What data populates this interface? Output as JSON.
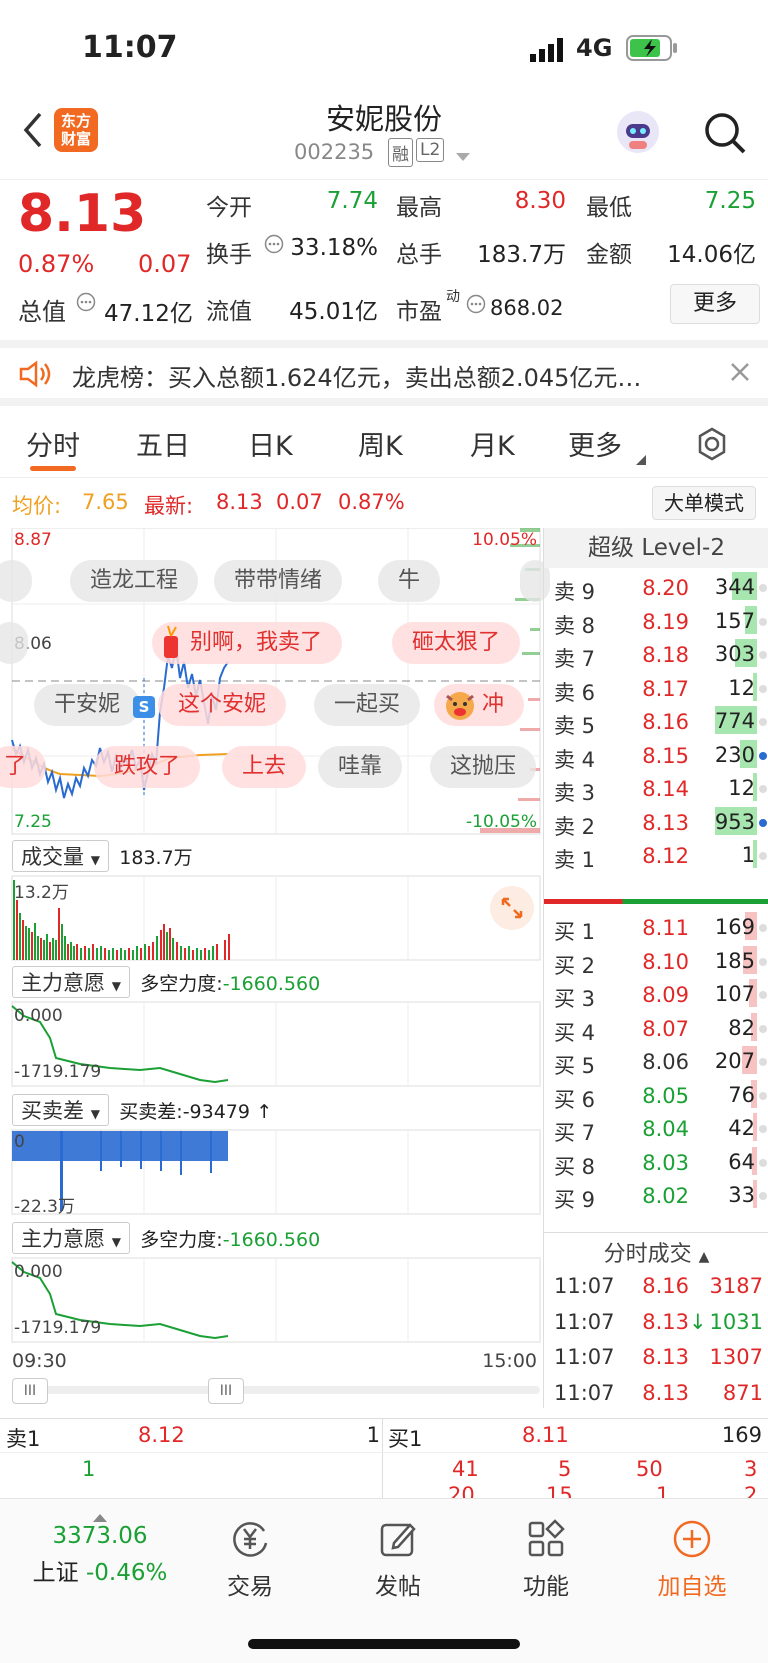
{
  "status": {
    "time": "11:07",
    "network": "4G"
  },
  "header": {
    "title": "安妮股份",
    "code": "002235",
    "badge1": "融",
    "badge2": "L2",
    "logo_line1": "东方",
    "logo_line2": "财富"
  },
  "quote": {
    "price": "8.13",
    "pct": "0.87%",
    "chg": "0.07",
    "open_label": "今开",
    "open": "7.74",
    "high_label": "最高",
    "high": "8.30",
    "low_label": "最低",
    "low": "7.25",
    "turnover_label": "换手",
    "turnover": "33.18%",
    "volume_label": "总手",
    "volume": "183.7万",
    "amount_label": "金额",
    "amount": "14.06亿",
    "mktcap_label": "总值",
    "mktcap": "47.12亿",
    "float_label": "流值",
    "float": "45.01亿",
    "pe_label": "市盈",
    "pe_sup": "动",
    "pe": "868.02",
    "more_button": "更多"
  },
  "notice": {
    "text": "龙虎榜：买入总额1.624亿元，卖出总额2.045亿元…"
  },
  "tabs": [
    "分时",
    "五日",
    "日K",
    "周K",
    "月K",
    "更多"
  ],
  "priceline": {
    "avg_label": "均价:",
    "avg": "7.65",
    "latest_label": "最新:",
    "latest": "8.13",
    "chg": "0.07",
    "pct": "0.87%",
    "mode_button": "大单模式"
  },
  "chart": {
    "price_top": "8.87",
    "price_mid": "8.06",
    "price_bottom": "7.25",
    "pct_top": "10.05%",
    "pct_bottom": "-10.05%",
    "vol_selector": "成交量",
    "vol_value": "183.7万",
    "vol_max": "13.2万",
    "ind1_selector": "主力意愿",
    "ind1_text": "多空力度:",
    "ind1_value": "-1660.560",
    "ind1_top": "0.000",
    "ind1_bottom": "-1719.179",
    "ind2_selector": "买卖差",
    "ind2_text": "买卖差:",
    "ind2_value": "-93479",
    "ind2_arrow": "↑",
    "ind2_top": "0",
    "ind2_bottom": "-22.3万",
    "ind3_selector": "主力意愿",
    "ind3_text": "多空力度:",
    "ind3_value": "-1660.560",
    "ind3_top": "0.000",
    "ind3_bottom": "-1719.179",
    "time_start": "09:30",
    "time_end": "15:00",
    "slider_grip": "III"
  },
  "bubbles": [
    "造龙工程",
    "带带情绪",
    "牛",
    "别啊，我卖了",
    "砸太狠了",
    "干安妮",
    "这个安妮",
    "一起买",
    "冲",
    "了",
    "跌攻了",
    "上去",
    "哇靠",
    "这抛压"
  ],
  "level2": {
    "title": "超级 Level-2",
    "sells": [
      {
        "label": "卖 9",
        "price": "8.20",
        "vol": "344"
      },
      {
        "label": "卖 8",
        "price": "8.19",
        "vol": "157"
      },
      {
        "label": "卖 7",
        "price": "8.18",
        "vol": "303"
      },
      {
        "label": "卖 6",
        "price": "8.17",
        "vol": "12"
      },
      {
        "label": "卖 5",
        "price": "8.16",
        "vol": "774"
      },
      {
        "label": "卖 4",
        "price": "8.15",
        "vol": "230"
      },
      {
        "label": "卖 3",
        "price": "8.14",
        "vol": "12"
      },
      {
        "label": "卖 2",
        "price": "8.13",
        "vol": "953"
      },
      {
        "label": "卖 1",
        "price": "8.12",
        "vol": "1"
      }
    ],
    "buys": [
      {
        "label": "买 1",
        "price": "8.11",
        "vol": "169"
      },
      {
        "label": "买 2",
        "price": "8.10",
        "vol": "185"
      },
      {
        "label": "买 3",
        "price": "8.09",
        "vol": "107"
      },
      {
        "label": "买 4",
        "price": "8.07",
        "vol": "82"
      },
      {
        "label": "买 5",
        "price": "8.06",
        "vol": "207"
      },
      {
        "label": "买 6",
        "price": "8.05",
        "vol": "76"
      },
      {
        "label": "买 7",
        "price": "8.04",
        "vol": "42"
      },
      {
        "label": "买 8",
        "price": "8.03",
        "vol": "64"
      },
      {
        "label": "买 9",
        "price": "8.02",
        "vol": "33"
      }
    ],
    "trades_title": "分时成交",
    "trades": [
      {
        "time": "11:07",
        "price": "8.16",
        "vol": "3187",
        "arrow": ""
      },
      {
        "time": "11:07",
        "price": "8.13",
        "vol": "1031",
        "arrow": "↓"
      },
      {
        "time": "11:07",
        "price": "8.13",
        "vol": "1307",
        "arrow": ""
      },
      {
        "time": "11:07",
        "price": "8.13",
        "vol": "871",
        "arrow": ""
      }
    ]
  },
  "bottom_quote": {
    "sell_label": "卖1",
    "sell_price": "8.12",
    "sell_vol": "1",
    "sell_detail": "1",
    "buy_label": "买1",
    "buy_price": "8.11",
    "buy_vol": "169",
    "buy_d1": "41",
    "buy_d2": "5",
    "buy_d3": "50",
    "buy_d4": "3",
    "buy_e1": "20",
    "buy_e2": "15",
    "buy_e3": "1",
    "buy_e4": "2"
  },
  "bottom_nav": {
    "index_value": "3373.06",
    "index_name": "上证",
    "index_pct": "-0.46%",
    "trade": "交易",
    "post": "发帖",
    "func": "功能",
    "add": "加自选"
  },
  "colors": {
    "red": "#e02828",
    "green": "#1aa034",
    "brand": "#f26a21",
    "blue_line": "#2a6bd1"
  }
}
